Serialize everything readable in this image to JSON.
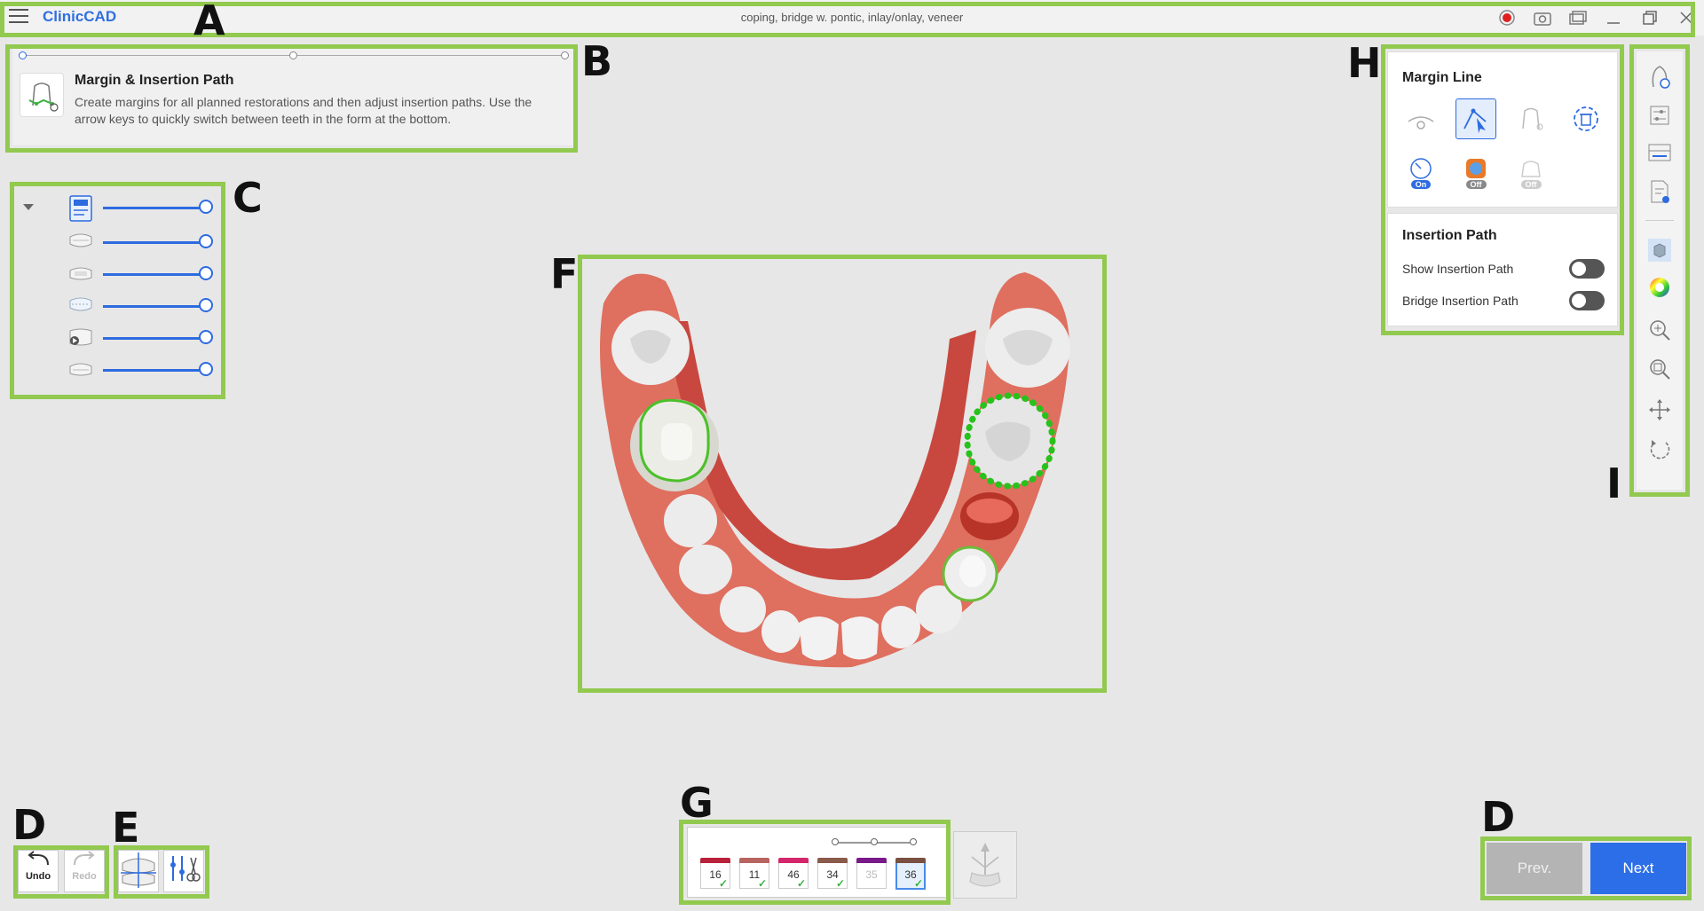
{
  "app": {
    "name": "ClinicCAD",
    "window_title": "coping, bridge w. pontic, inlay/onlay, veneer"
  },
  "annotations": {
    "a": "A",
    "b": "B",
    "c": "C",
    "d1": "D",
    "d2": "D",
    "e": "E",
    "f": "F",
    "g": "G",
    "h": "H",
    "i": "I"
  },
  "step": {
    "title": "Margin & Insertion Path",
    "description": "Create margins for all planned restorations and then adjust insertion paths. Use the arrow keys to quickly switch between teeth in the form at the bottom."
  },
  "margin_line": {
    "title": "Margin Line",
    "tools": [
      "draw-margin-icon",
      "edit-margin-icon",
      "auto-margin-icon",
      "delete-margin-icon",
      "magnet-icon",
      "undercut-icon",
      "die-icon"
    ],
    "toggle_labels": {
      "magnet": "On",
      "undercut": "Off",
      "die": "Off"
    }
  },
  "insertion_path": {
    "title": "Insertion Path",
    "show_label": "Show Insertion Path",
    "bridge_label": "Bridge Insertion Path",
    "show_on": false,
    "bridge_on": false
  },
  "history": {
    "undo_label": "Undo",
    "redo_label": "Redo"
  },
  "teeth": [
    {
      "num": "16",
      "color": "#b8213a",
      "done": true,
      "active": false,
      "disabled": false
    },
    {
      "num": "11",
      "color": "#b86460",
      "done": true,
      "active": false,
      "disabled": false
    },
    {
      "num": "46",
      "color": "#d4266a",
      "done": true,
      "active": false,
      "disabled": false
    },
    {
      "num": "34",
      "color": "#8a5a4a",
      "done": true,
      "active": false,
      "disabled": false
    },
    {
      "num": "35",
      "color": "#7a1a8a",
      "done": false,
      "active": false,
      "disabled": true
    },
    {
      "num": "36",
      "color": "#7a5040",
      "done": true,
      "active": true,
      "disabled": false
    }
  ],
  "nav": {
    "prev_label": "Prev.",
    "next_label": "Next"
  }
}
